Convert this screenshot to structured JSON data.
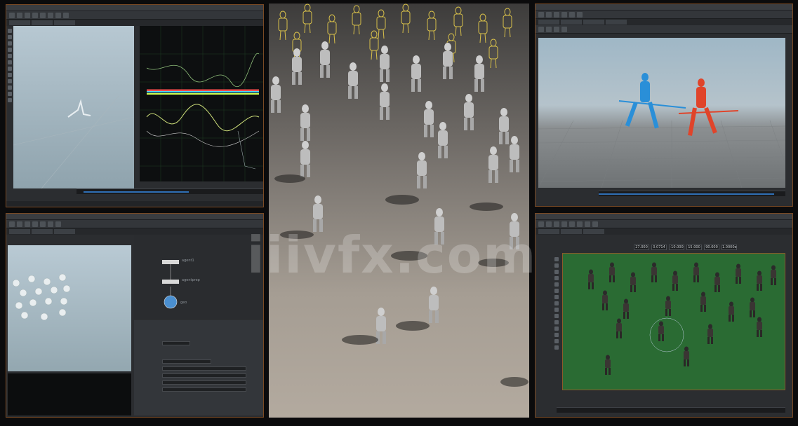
{
  "watermark": {
    "text": "iiivfx.com"
  },
  "panels": {
    "anim_editor": {
      "title": "Animation Editor"
    },
    "network": {
      "node_a": "agent1",
      "node_b": "agentprep",
      "node_c": "geo"
    },
    "crowd_sim": {},
    "combat_view": {},
    "green_view": {
      "fields": [
        "27.000",
        "0.0714",
        "-10.000",
        "15.000",
        "90.000",
        "1.0000e"
      ]
    }
  },
  "colors": {
    "accent_border": "#7a4a24",
    "timeline_blue": "#2f6fb5",
    "green_bg": "#2a6b33"
  }
}
